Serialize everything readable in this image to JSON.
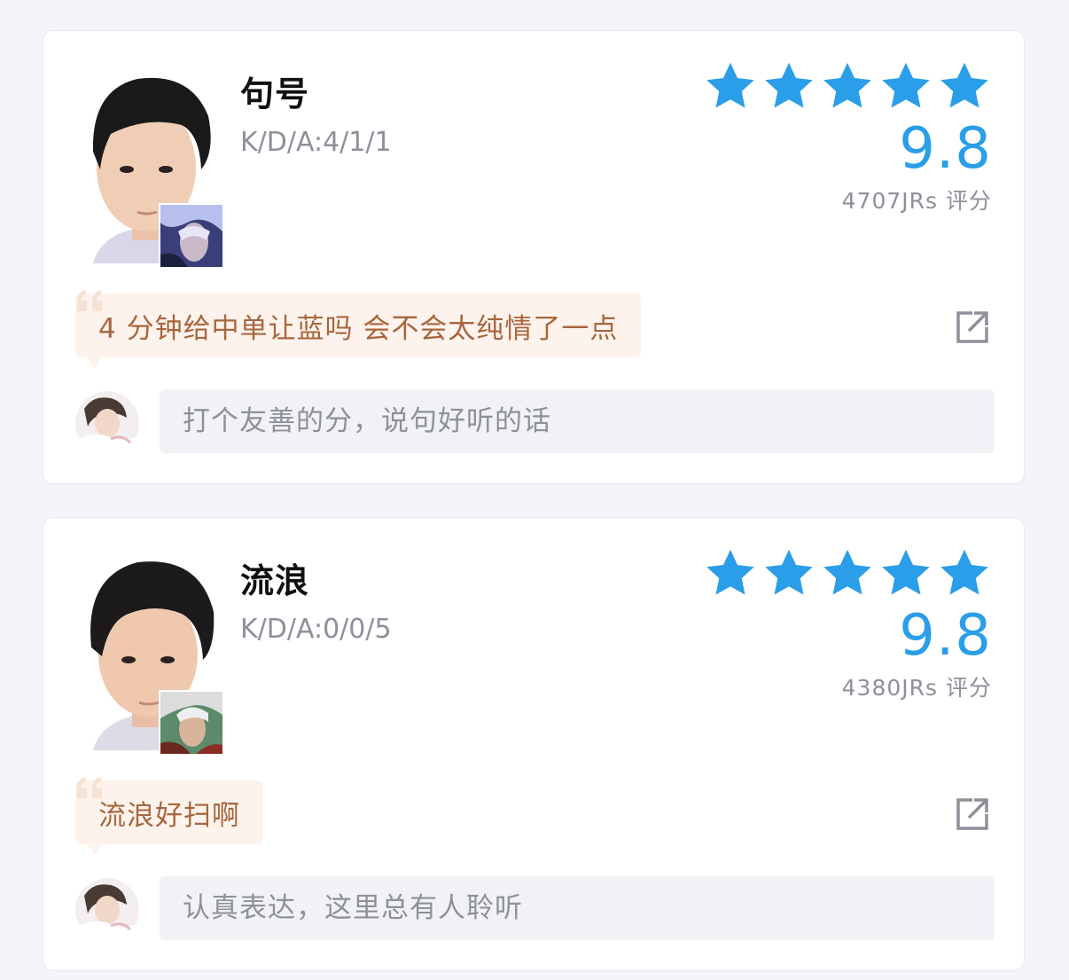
{
  "colors": {
    "accent_blue": "#2a9ee8",
    "quote_text": "#a7663e",
    "quote_bg": "#fdf3ec",
    "muted_text": "#8e909a"
  },
  "cards": [
    {
      "player_name": "句号",
      "kda": "K/D/A:4/1/1",
      "rating_stars": 5,
      "score": "9.8",
      "votes": "4707JRs 评分",
      "quote": "4 分钟给中单让蓝吗 会不会太纯情了一点",
      "comment_placeholder": "打个友善的分，说句好听的话",
      "icons": [
        "player-photo",
        "hero-portrait",
        "star-icon",
        "quote-icon",
        "share-icon",
        "user-avatar"
      ]
    },
    {
      "player_name": "流浪",
      "kda": "K/D/A:0/0/5",
      "rating_stars": 5,
      "score": "9.8",
      "votes": "4380JRs 评分",
      "quote": "流浪好扫啊",
      "comment_placeholder": "认真表达，这里总有人聆听",
      "icons": [
        "player-photo",
        "hero-portrait",
        "star-icon",
        "quote-icon",
        "share-icon",
        "user-avatar"
      ]
    }
  ]
}
